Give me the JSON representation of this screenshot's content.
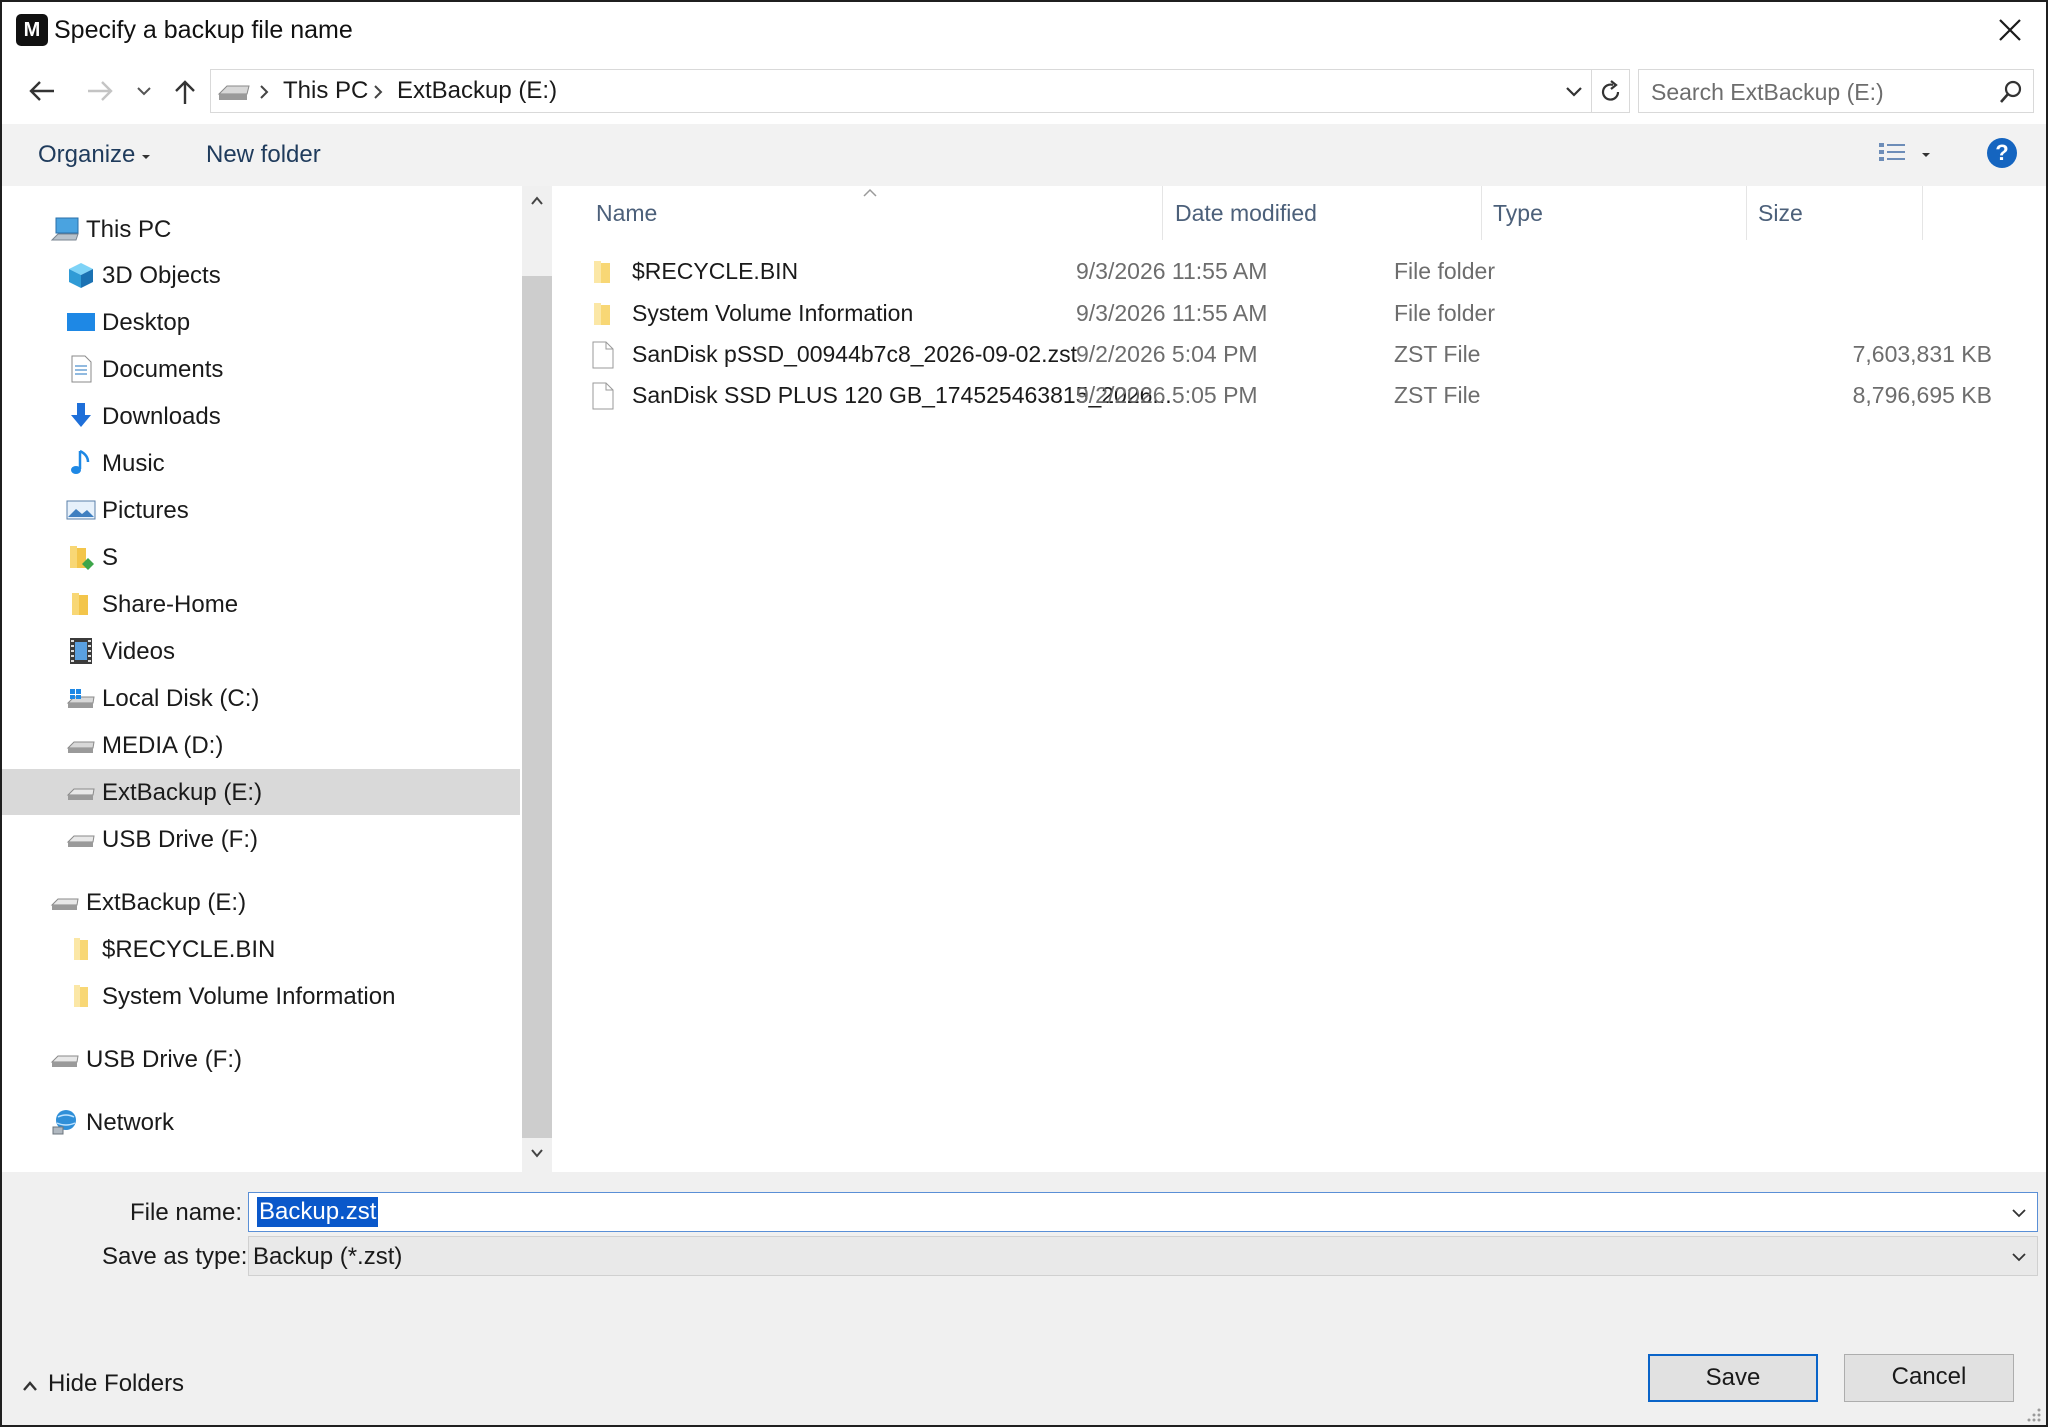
{
  "window": {
    "app_icon_letter": "M",
    "title": "Specify a backup file name"
  },
  "address": {
    "crumbs": [
      "This PC",
      "ExtBackup (E:)"
    ],
    "search_placeholder": "Search ExtBackup (E:)"
  },
  "toolbar": {
    "organize_label": "Organize",
    "new_folder_label": "New folder",
    "help_label": "?"
  },
  "tree": {
    "this_pc": "This PC",
    "items": [
      {
        "label": "3D Objects",
        "icon": "3d-objects-icon"
      },
      {
        "label": "Desktop",
        "icon": "desktop-icon"
      },
      {
        "label": "Documents",
        "icon": "documents-icon"
      },
      {
        "label": "Downloads",
        "icon": "downloads-icon"
      },
      {
        "label": "Music",
        "icon": "music-icon"
      },
      {
        "label": "Pictures",
        "icon": "pictures-icon"
      },
      {
        "label": "S",
        "icon": "folder-icon"
      },
      {
        "label": "Share-Home",
        "icon": "folder-icon"
      },
      {
        "label": "Videos",
        "icon": "videos-icon"
      },
      {
        "label": "Local Disk (C:)",
        "icon": "local-disk-icon"
      },
      {
        "label": "MEDIA (D:)",
        "icon": "drive-icon"
      },
      {
        "label": "ExtBackup (E:)",
        "icon": "drive-icon",
        "selected": true
      },
      {
        "label": "USB Drive (F:)",
        "icon": "drive-icon"
      }
    ],
    "extbackup_root": "ExtBackup (E:)",
    "extbackup_children": [
      "$RECYCLE.BIN",
      "System Volume Information"
    ],
    "usb_root": "USB Drive (F:)",
    "network": "Network"
  },
  "filelist": {
    "columns": {
      "name": "Name",
      "date": "Date modified",
      "type": "Type",
      "size": "Size"
    },
    "rows": [
      {
        "name": "$RECYCLE.BIN",
        "date": "9/3/2026 11:55 AM",
        "type": "File folder",
        "size": "",
        "icon": "folder-icon"
      },
      {
        "name": "System Volume Information",
        "date": "9/3/2026 11:55 AM",
        "type": "File folder",
        "size": "",
        "icon": "folder-icon"
      },
      {
        "name": "SanDisk pSSD_00944b7c8_2026-09-02.zst",
        "date": "9/2/2026 5:04 PM",
        "type": "ZST File",
        "size": "7,603,831 KB",
        "icon": "file-icon"
      },
      {
        "name": "SanDisk SSD PLUS 120 GB_174525463815_2026...",
        "date": "9/2/2026 5:05 PM",
        "type": "ZST File",
        "size": "8,796,695 KB",
        "icon": "file-icon"
      }
    ]
  },
  "bottom": {
    "file_name_label": "File name:",
    "file_name_value": "Backup.zst",
    "save_type_label": "Save as type:",
    "save_type_value": "Backup (*.zst)",
    "hide_folders_label": "Hide Folders",
    "save_label": "Save",
    "cancel_label": "Cancel"
  },
  "colors": {
    "accent": "#0a58ca",
    "selected_bg": "#d9d9d9",
    "toolbar_bg": "#f2f2f2",
    "folder_yellow": "#f8d775"
  }
}
